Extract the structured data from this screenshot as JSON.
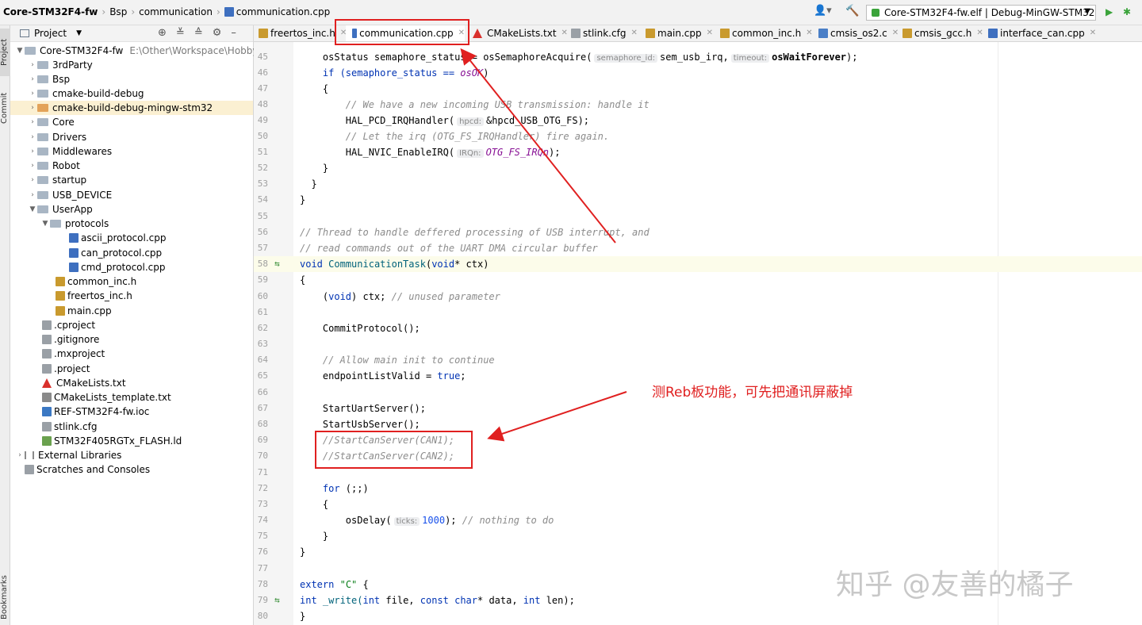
{
  "breadcrumb": {
    "project": "Core-STM32F4-fw",
    "folder1": "Bsp",
    "folder2": "communication",
    "file": "communication.cpp"
  },
  "run_config": "Core-STM32F4-fw.elf | Debug-MinGW-STM32",
  "left_strip": {
    "project": "Project",
    "commit": "Commit",
    "bookmarks": "Bookmarks"
  },
  "project_panel": {
    "title": "Project",
    "root": {
      "name": "Core-STM32F4-fw",
      "path": "E:\\Other\\Workspace\\Hobby\\R"
    },
    "items": [
      "3rdParty",
      "Bsp",
      "cmake-build-debug",
      "cmake-build-debug-mingw-stm32",
      "Core",
      "Drivers",
      "Middlewares",
      "Robot",
      "startup",
      "USB_DEVICE",
      "UserApp",
      "protocols",
      "ascii_protocol.cpp",
      "can_protocol.cpp",
      "cmd_protocol.cpp",
      "common_inc.h",
      "freertos_inc.h",
      "main.cpp",
      ".cproject",
      ".gitignore",
      ".mxproject",
      ".project",
      "CMakeLists.txt",
      "CMakeLists_template.txt",
      "REF-STM32F4-fw.ioc",
      "stlink.cfg",
      "STM32F405RGTx_FLASH.ld",
      "External Libraries",
      "Scratches and Consoles"
    ]
  },
  "tabs": [
    "freertos_inc.h",
    "communication.cpp",
    "CMakeLists.txt",
    "stlink.cfg",
    "main.cpp",
    "common_inc.h",
    "cmsis_os2.c",
    "cmsis_gcc.h",
    "interface_can.cpp"
  ],
  "editor": {
    "line_numbers": [
      "45",
      "46",
      "47",
      "48",
      "49",
      "50",
      "51",
      "52",
      "53",
      "54",
      "55",
      "56",
      "57",
      "58",
      "59",
      "60",
      "61",
      "62",
      "63",
      "64",
      "65",
      "66",
      "67",
      "68",
      "69",
      "70",
      "71",
      "72",
      "73",
      "74",
      "75",
      "76",
      "77",
      "78",
      "79",
      "80"
    ],
    "l45": {
      "a": "    osStatus semaphore_status = osSemaphoreAcquire(",
      "hint1": "semaphore_id:",
      "b": "sem_usb_irq,",
      "hint2": "timeout:",
      "c": "osWaitForever",
      "d": ");"
    },
    "l46": {
      "a": "    if (semaphore_status == ",
      "b": "osOK",
      "c": ")"
    },
    "l47": "    {",
    "l48": "        // We have a new incoming USB transmission: handle it",
    "l49": {
      "a": "        HAL_PCD_IRQHandler(",
      "hint": "hpcd:",
      "b": "&hpcd_USB_OTG_FS);"
    },
    "l50": "        // Let the irq (OTG_FS_IRQHandler) fire again.",
    "l51": {
      "a": "        HAL_NVIC_EnableIRQ(",
      "hint": "IRQn:",
      "b": "OTG_FS_IRQn",
      "c": ");"
    },
    "l52": "    }",
    "l53": "  }",
    "l54": "}",
    "l56": "// Thread to handle deffered processing of USB interrupt, and",
    "l57": "// read commands out of the UART DMA circular buffer",
    "l58": {
      "kw": "void",
      "fn": "CommunicationTask",
      "a": "(",
      "kw2": "void",
      "b": "* ctx)"
    },
    "l59": "{",
    "l60": {
      "a": "    (",
      "kw": "void",
      "b": ") ctx; ",
      "cm": "// unused parameter"
    },
    "l62": "    CommitProtocol();",
    "l64": "    // Allow main init to continue",
    "l65": {
      "a": "    endpointListValid = ",
      "kw": "true",
      "b": ";"
    },
    "l67": "    StartUartServer();",
    "l68": "    StartUsbServer();",
    "l69": "    //StartCanServer(CAN1);",
    "l70": "    //StartCanServer(CAN2);",
    "l72": {
      "kw": "    for",
      "a": " (;;)"
    },
    "l73": "    {",
    "l74": {
      "a": "        osDelay(",
      "hint": "ticks:",
      "num": "1000",
      "b": "); ",
      "cm": "// nothing to do"
    },
    "l75": "    }",
    "l76": "}",
    "l78": {
      "kw": "extern",
      "str": "\"C\"",
      "a": " {"
    },
    "l79": {
      "kw": "int",
      "a": " _write(",
      "kw2": "int",
      "b": " file, ",
      "kw3": "const char",
      "c": "* data, ",
      "kw4": "int",
      "d": " len);"
    },
    "l80": "}"
  },
  "annotation": "测Reb板功能，可先把通讯屏蔽掉",
  "watermark": "知乎 @友善的橘子",
  "colors": {
    "annotation_red": "#e02020",
    "selected_row": "#fbf0d2"
  }
}
